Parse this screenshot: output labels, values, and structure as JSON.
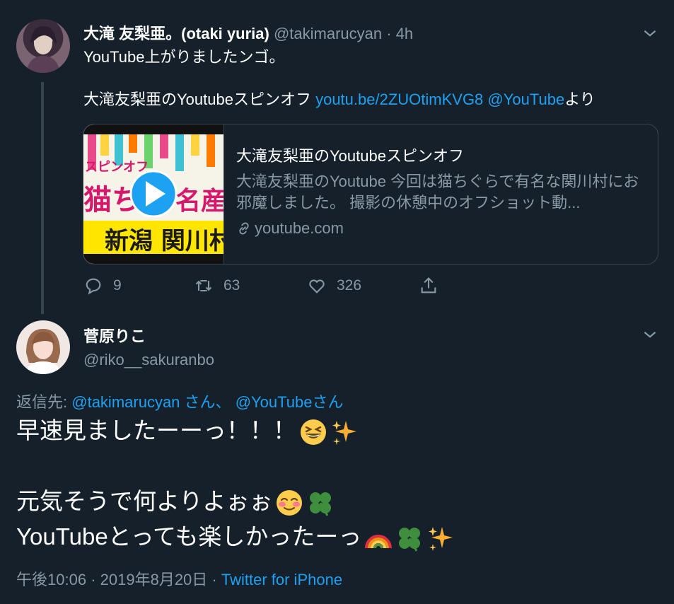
{
  "tweet1": {
    "display_name": "大滝 友梨亜。(otaki yuria)",
    "handle": "@takimarucyan",
    "separator": "·",
    "time": "4h",
    "line1": "YouTube上がりましたンゴ。",
    "line2_text": "大滝友梨亜のYoutubeスピンオフ",
    "line2_link1": "youtu.be/2ZUOtimKVG8",
    "line2_link2": "@YouTube",
    "line2_suffix": "より",
    "card": {
      "title": "大滝友梨亜のYoutubeスピンオフ",
      "description": "大滝友梨亜のYoutube 今回は猫ちぐらで有名な関川村にお邪魔しました。 撮影の休憩中のオフショット動...",
      "domain": "youtube.com",
      "thumb_text_top": "スピンオフ",
      "thumb_text_mid_left": "猫ち",
      "thumb_text_mid_right": "名産",
      "thumb_text_bottom": "新潟 関川村"
    },
    "actions": {
      "replies": "9",
      "retweets": "63",
      "likes": "326"
    }
  },
  "tweet2": {
    "display_name": "菅原りこ",
    "handle": "@riko__sakuranbo",
    "reply_prefix": "返信先:",
    "reply_user1": "@takimarucyan",
    "reply_san1": "さん、",
    "reply_user2": "@YouTube",
    "reply_san2": "さん",
    "line1": "早速見ましたーーっ！！！",
    "line2": "元気そうで何よりよぉぉ",
    "line3": "YouTubeとっても楽しかったーっ",
    "time": "午後10:06",
    "dot": "·",
    "date": "2019年8月20日",
    "dot2": "·",
    "source": "Twitter for iPhone"
  },
  "colors": {
    "background": "#15202b",
    "muted": "#8899a6",
    "link": "#1da1f2",
    "border": "#38444d",
    "play": "#1da1f2"
  }
}
